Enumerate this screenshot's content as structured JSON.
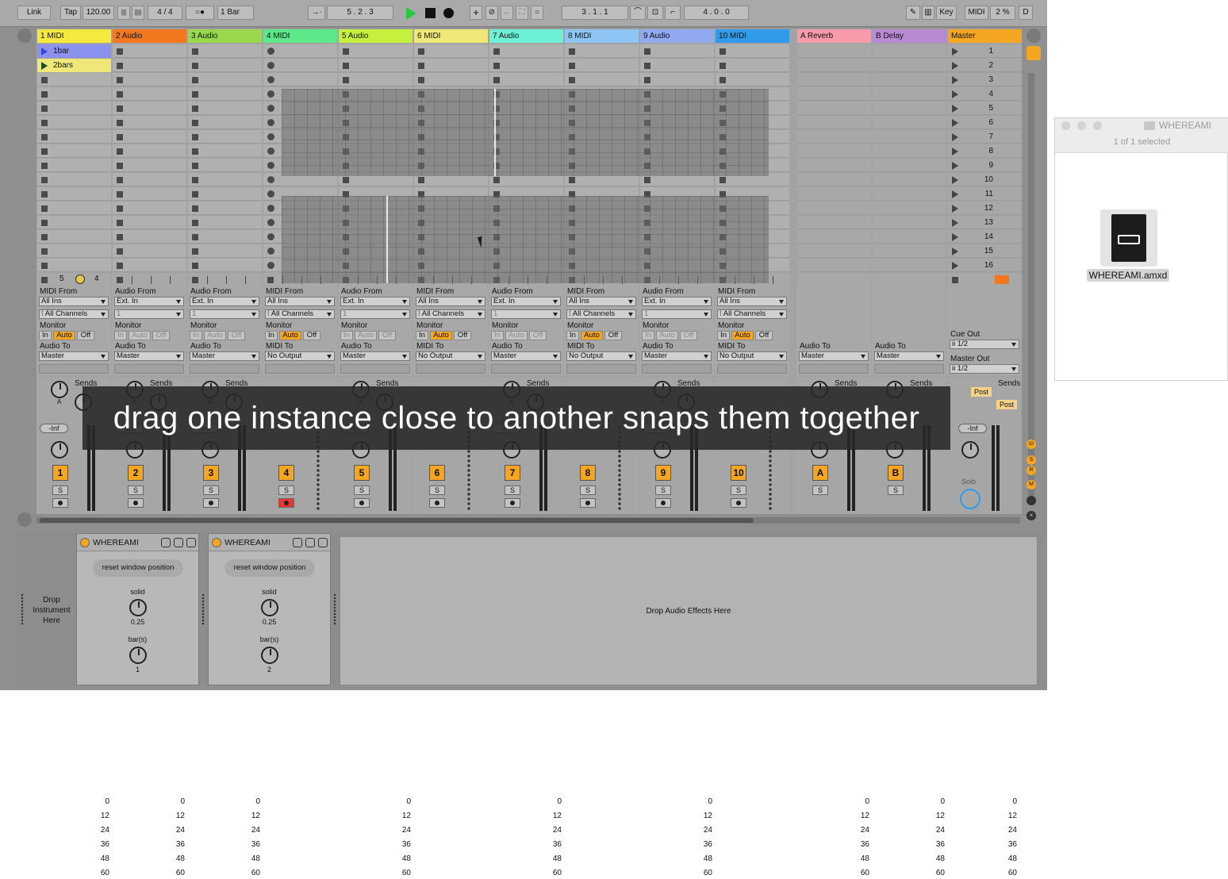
{
  "topbar": {
    "link": "Link",
    "tap": "Tap",
    "tempo": "120.00",
    "signature": "4 / 4",
    "quantize": "1 Bar",
    "arrangement_position": "5 .  2 .  3",
    "loop_start": "3 .  1 .  1",
    "loop_length": "4 .  0 .  0",
    "key": "Key",
    "midi": "MIDI",
    "cpu": "2 %",
    "disk": "D"
  },
  "tracks": [
    {
      "name": "1 MIDI",
      "color": "#f4ea3d",
      "type": "midi",
      "number": "1"
    },
    {
      "name": "2 Audio",
      "color": "#f2771f",
      "type": "audio",
      "number": "2"
    },
    {
      "name": "3 Audio",
      "color": "#9ad94d",
      "type": "audio",
      "number": "3"
    },
    {
      "name": "4 MIDI",
      "color": "#5ee889",
      "type": "midi",
      "number": "4"
    },
    {
      "name": "5 Audio",
      "color": "#c7ef3d",
      "type": "audio",
      "number": "5"
    },
    {
      "name": "6 MIDI",
      "color": "#efe878",
      "type": "midi",
      "number": "6"
    },
    {
      "name": "7 Audio",
      "color": "#6ef0d6",
      "type": "audio",
      "number": "7"
    },
    {
      "name": "8 MIDI",
      "color": "#8ec5f4",
      "type": "midi",
      "number": "8"
    },
    {
      "name": "9 Audio",
      "color": "#91a9f0",
      "type": "audio",
      "number": "9"
    },
    {
      "name": "10 MIDI",
      "color": "#2f9be9",
      "type": "midi",
      "number": "10"
    }
  ],
  "returns": [
    {
      "name": "A Reverb",
      "color": "#f79aa9",
      "number": "A"
    },
    {
      "name": "B Delay",
      "color": "#b88ad1",
      "number": "B"
    }
  ],
  "master": {
    "name": "Master",
    "color": "#f4a623",
    "scenes": [
      "1",
      "2",
      "3",
      "4",
      "5",
      "6",
      "7",
      "8",
      "9",
      "10",
      "11",
      "12",
      "13",
      "14",
      "15",
      "16"
    ],
    "cue_out_label": "Cue Out",
    "cue_out": "ii 1/2",
    "master_out_label": "Master Out",
    "master_out": "ii 1/2",
    "solo": "Solo",
    "post": "Post"
  },
  "clips": [
    {
      "name": "1bar",
      "color": "#8b91ef"
    },
    {
      "name": "2bars",
      "color": "#efe878"
    }
  ],
  "track1_footer": {
    "left": "5",
    "right": "4"
  },
  "io": {
    "midi_from": "MIDI From",
    "audio_from": "Audio From",
    "all_ins": "All Ins",
    "ext_in": "Ext. In",
    "all_channels": "All Channels",
    "ch1": "1",
    "monitor": "Monitor",
    "in": "In",
    "auto": "Auto",
    "off": "Off",
    "audio_to": "Audio To",
    "midi_to": "MIDI To",
    "master": "Master",
    "no_output": "No Output"
  },
  "mixer": {
    "sends": "Sends",
    "inf": "-Inf",
    "scale": [
      "0",
      "12",
      "24",
      "36",
      "48",
      "60"
    ],
    "s": "S",
    "a": "A",
    "b": "B"
  },
  "caption": "drag one instance close to another snaps them together",
  "devices": [
    {
      "title": "WHEREAMI",
      "reset": "reset window position",
      "solid_label": "solid",
      "solid_value": "0.25",
      "bars_label": "bar(s)",
      "bars_value": "1"
    },
    {
      "title": "WHEREAMI",
      "reset": "reset window position",
      "solid_label": "solid",
      "solid_value": "0.25",
      "bars_label": "bar(s)",
      "bars_value": "2"
    }
  ],
  "drop_instrument": "Drop Instrument Here",
  "drop_effects": "Drop Audio Effects Here",
  "finder": {
    "title": "WHEREAMI",
    "status": "1 of 1 selected",
    "file": "WHEREAMI.amxd"
  }
}
